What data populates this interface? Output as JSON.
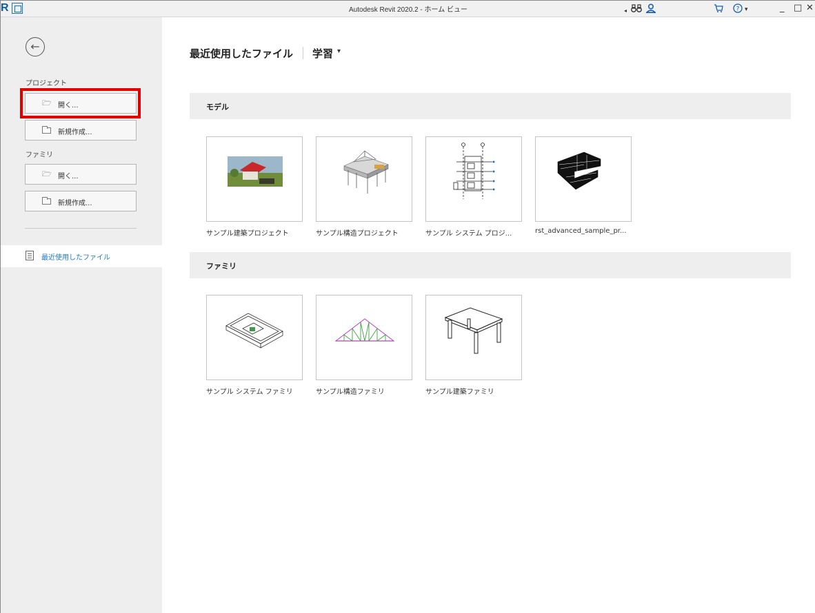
{
  "titlebar": {
    "app_icon": "revit-logo-icon",
    "title": "Autodesk Revit 2020.2 - ホーム ビュー",
    "minimize": "_",
    "maximize": "□",
    "close": "✕"
  },
  "sidebar": {
    "project_label": "プロジェクト",
    "project_open": "開く...",
    "project_new": "新規作成...",
    "family_label": "ファミリ",
    "family_open": "開く...",
    "family_new": "新規作成...",
    "recent_files": "最近使用したファイル"
  },
  "main": {
    "tab_recent": "最近使用したファイル",
    "tab_learn": "学習",
    "models_header": "モデル",
    "families_header": "ファミリ",
    "models": [
      {
        "caption": "サンプル建築プロジェクト",
        "icon": "architecture-sample-thumbnail"
      },
      {
        "caption": "サンプル構造プロジェクト",
        "icon": "structure-sample-thumbnail"
      },
      {
        "caption": "サンプル システム プロジ...",
        "icon": "systems-sample-thumbnail"
      },
      {
        "caption": "rst_advanced_sample_pr...",
        "icon": "advanced-structure-thumbnail"
      }
    ],
    "families": [
      {
        "caption": "サンプル システム ファミリ",
        "icon": "system-family-thumbnail"
      },
      {
        "caption": "サンプル構造ファミリ",
        "icon": "truss-family-thumbnail"
      },
      {
        "caption": "サンプル建築ファミリ",
        "icon": "table-family-thumbnail"
      }
    ]
  },
  "colors": {
    "sidebar_bg": "#eeeeee",
    "highlight": "#e00000",
    "link_blue": "#1f7ac2"
  }
}
